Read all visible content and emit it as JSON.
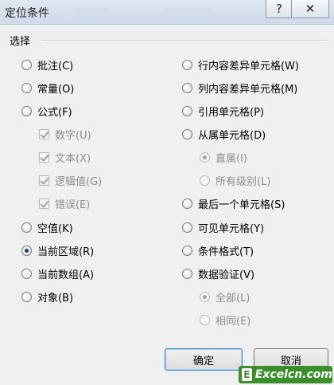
{
  "window": {
    "title": "定位条件",
    "help_glyph": "?",
    "close_glyph": "✕"
  },
  "group": {
    "label": "选择"
  },
  "left_options": [
    {
      "label": "批注(C)",
      "type": "radio",
      "checked": false,
      "disabled": false
    },
    {
      "label": "常量(O)",
      "type": "radio",
      "checked": false,
      "disabled": false
    },
    {
      "label": "公式(F)",
      "type": "radio",
      "checked": false,
      "disabled": false
    },
    {
      "label": "数字(U)",
      "type": "check",
      "checked": true,
      "disabled": true
    },
    {
      "label": "文本(X)",
      "type": "check",
      "checked": true,
      "disabled": true
    },
    {
      "label": "逻辑值(G)",
      "type": "check",
      "checked": true,
      "disabled": true
    },
    {
      "label": "错误(E)",
      "type": "check",
      "checked": true,
      "disabled": true
    },
    {
      "label": "空值(K)",
      "type": "radio",
      "checked": false,
      "disabled": false
    },
    {
      "label": "当前区域(R)",
      "type": "radio",
      "checked": true,
      "disabled": false
    },
    {
      "label": "当前数组(A)",
      "type": "radio",
      "checked": false,
      "disabled": false
    },
    {
      "label": "对象(B)",
      "type": "radio",
      "checked": false,
      "disabled": false
    }
  ],
  "right_options": [
    {
      "label": "行内容差异单元格(W)",
      "type": "radio",
      "checked": false,
      "disabled": false
    },
    {
      "label": "列内容差异单元格(M)",
      "type": "radio",
      "checked": false,
      "disabled": false
    },
    {
      "label": "引用单元格(P)",
      "type": "radio",
      "checked": false,
      "disabled": false
    },
    {
      "label": "从属单元格(D)",
      "type": "radio",
      "checked": false,
      "disabled": false
    },
    {
      "label": "直属(I)",
      "type": "radio",
      "checked": true,
      "disabled": true
    },
    {
      "label": "所有级别(L)",
      "type": "radio",
      "checked": false,
      "disabled": true
    },
    {
      "label": "最后一个单元格(S)",
      "type": "radio",
      "checked": false,
      "disabled": false
    },
    {
      "label": "可见单元格(Y)",
      "type": "radio",
      "checked": false,
      "disabled": false
    },
    {
      "label": "条件格式(T)",
      "type": "radio",
      "checked": false,
      "disabled": false
    },
    {
      "label": "数据验证(V)",
      "type": "radio",
      "checked": false,
      "disabled": false
    },
    {
      "label": "全部(L)",
      "type": "radio",
      "checked": true,
      "disabled": true
    },
    {
      "label": "相同(E)",
      "type": "radio",
      "checked": false,
      "disabled": true
    }
  ],
  "buttons": {
    "ok": "确定",
    "cancel": "取消"
  },
  "watermark": {
    "icon_letter": "E",
    "text": "Excelcn.com"
  },
  "colors": {
    "selected_dot": "#1a3e88",
    "default_button_border": "#3c7fb1",
    "watermark_bg": "#3a8f2b"
  }
}
